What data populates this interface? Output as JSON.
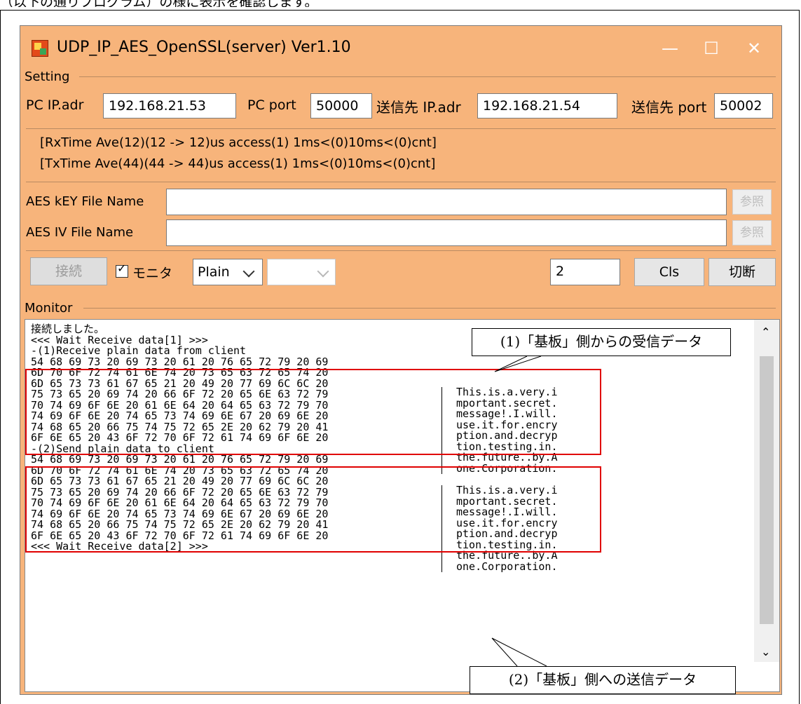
{
  "document": {
    "top_text": "（以下の通りプログラム）の様に表示を確認します。"
  },
  "window": {
    "title": "UDP_IP_AES_OpenSSL(server) Ver1.10",
    "minimize_glyph": "—",
    "maximize_glyph": "☐",
    "close_glyph": "✕"
  },
  "setting": {
    "legend": "Setting",
    "pc_ip_label": "PC IP.adr",
    "pc_ip_value": "192.168.21.53",
    "pc_port_label": "PC port",
    "pc_port_value": "50000",
    "dest_ip_label": "送信先 IP.adr",
    "dest_ip_value": "192.168.21.54",
    "dest_port_label": "送信先 port",
    "dest_port_value": "50002"
  },
  "status": {
    "rx_line": "[RxTime Ave(12)(12 -> 12)us access(1) 1ms<(0)10ms<(0)cnt]",
    "tx_line": "[TxTime Ave(44)(44 -> 44)us access(1) 1ms<(0)10ms<(0)cnt]"
  },
  "aes": {
    "key_label": "AES kEY File Name",
    "key_value": "",
    "iv_label": "AES IV File Name",
    "iv_value": "",
    "browse_label": "参照"
  },
  "controls": {
    "connect_label": "接続",
    "monitor_check_label": "モニタ",
    "mode_value": "Plain",
    "second_select_value": "",
    "count_value": "2",
    "cls_label": "Cls",
    "disconnect_label": "切断"
  },
  "monitor": {
    "legend": "Monitor",
    "lines": [
      "接続しました。",
      "<<< Wait Receive data[1] >>>",
      "-(1)Receive plain data from client",
      "54 68 69 73 20 69 73 20 61 20 76 65 72 79 20 69",
      "6D 70 6F 72 74 61 6E 74 20 73 65 63 72 65 74 20",
      "6D 65 73 73 61 67 65 21 20 49 20 77 69 6C 6C 20",
      "75 73 65 20 69 74 20 66 6F 72 20 65 6E 63 72 79",
      "70 74 69 6F 6E 20 61 6E 64 20 64 65 63 72 79 70",
      "74 69 6F 6E 20 74 65 73 74 69 6E 67 20 69 6E 20",
      "74 68 65 20 66 75 74 75 72 65 2E 20 62 79 20 41",
      "6F 6E 65 20 43 6F 72 70 6F 72 61 74 69 6F 6E 20",
      "-(2)Send plain data to client",
      "54 68 69 73 20 69 73 20 61 20 76 65 72 79 20 69",
      "6D 70 6F 72 74 61 6E 74 20 73 65 63 72 65 74 20",
      "6D 65 73 73 61 67 65 21 20 49 20 77 69 6C 6C 20",
      "75 73 65 20 69 74 20 66 6F 72 20 65 6E 63 72 79",
      "70 74 69 6F 6E 20 61 6E 64 20 64 65 63 72 79 70",
      "74 69 6F 6E 20 74 65 73 74 69 6E 67 20 69 6E 20",
      "74 68 65 20 66 75 74 75 72 65 2E 20 62 79 20 41",
      "6F 6E 65 20 43 6F 72 70 6F 72 61 74 69 6F 6E 20",
      "<<< Wait Receive data[2] >>>"
    ],
    "ascii_rx": [
      "This.is.a.very.i",
      "mportant.secret.",
      "message!.I.will.",
      "use.it.for.encry",
      "ption.and.decryp",
      "tion.testing.in.",
      "the.future..by.A",
      "one.Corporation."
    ],
    "ascii_tx": [
      "This.is.a.very.i",
      "mportant.secret.",
      "message!.I.will.",
      "use.it.for.encry",
      "ption.and.decryp",
      "tion.testing.in.",
      "the.future..by.A",
      "one.Corporation."
    ]
  },
  "annotations": {
    "rx_callout": "(1)「基板」側からの受信データ",
    "tx_callout": "(2)「基板」側への送信データ"
  },
  "colors": {
    "window_bg": "#f7b47b",
    "highlight_red": "#e00000"
  }
}
